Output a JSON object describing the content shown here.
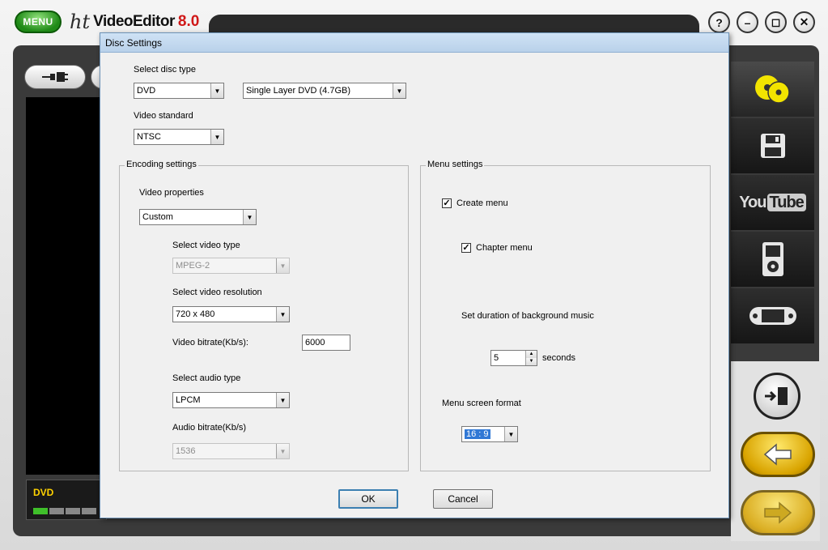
{
  "app": {
    "menu_label": "MENU",
    "brand_ht": "ht",
    "brand_name": "VideoEditor",
    "brand_version": "8.0",
    "window_controls": [
      "?",
      "–",
      "◻",
      "✕"
    ],
    "format_label": "DVD",
    "export_targets": [
      "disc-icon",
      "floppy-save-icon",
      "youtube-icon",
      "ipod-icon",
      "psp-icon"
    ],
    "youtube_text_you": "You",
    "youtube_text_tube": "Tube"
  },
  "dialog": {
    "title": "Disc Settings",
    "disc_type_label": "Select disc type",
    "disc_type_value": "DVD",
    "disc_layer_value": "Single Layer DVD (4.7GB)",
    "video_standard_label": "Video standard",
    "video_standard_value": "NTSC",
    "encoding": {
      "group_label": "Encoding settings",
      "video_properties_label": "Video properties",
      "video_properties_value": "Custom",
      "video_type_label": "Select video type",
      "video_type_value": "MPEG-2",
      "video_resolution_label": "Select video resolution",
      "video_resolution_value": "720 x 480",
      "video_bitrate_label": "Video bitrate(Kb/s):",
      "video_bitrate_value": "6000",
      "audio_type_label": "Select audio type",
      "audio_type_value": "LPCM",
      "audio_bitrate_label": "Audio bitrate(Kb/s)",
      "audio_bitrate_value": "1536"
    },
    "menu": {
      "group_label": "Menu settings",
      "create_menu_label": "Create menu",
      "create_menu_checked": true,
      "chapter_menu_label": "Chapter menu",
      "chapter_menu_checked": true,
      "bg_music_label": "Set duration of background music",
      "bg_music_value": "5",
      "bg_music_unit": "seconds",
      "screen_format_label": "Menu screen format",
      "screen_format_value": "16 : 9"
    },
    "ok_label": "OK",
    "cancel_label": "Cancel"
  }
}
